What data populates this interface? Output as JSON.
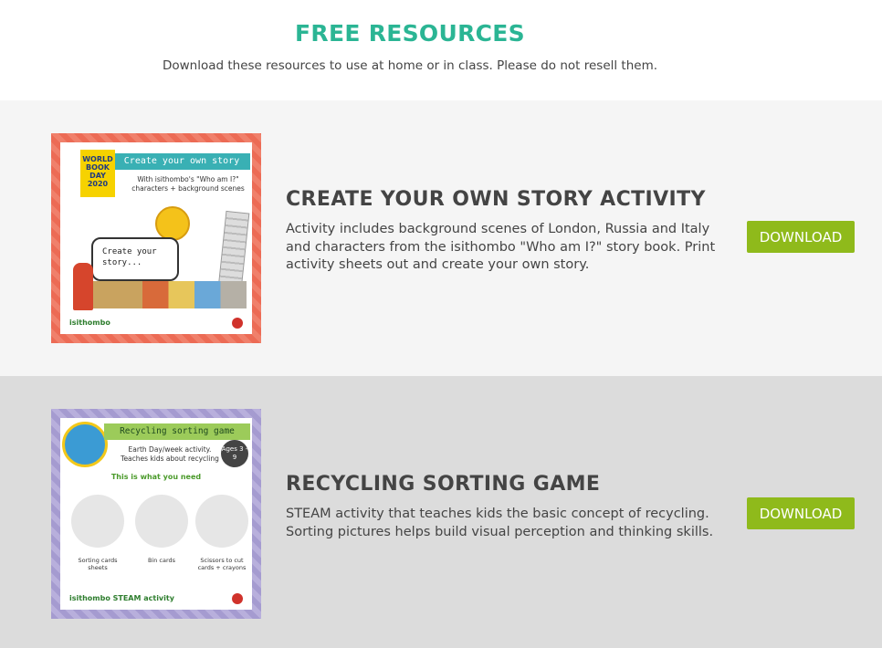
{
  "header": {
    "title": "FREE RESOURCES",
    "subtitle": "Download these resources to use at home or in class. Please do not resell them."
  },
  "resources": [
    {
      "title": "CREATE YOUR OWN STORY ACTIVITY",
      "description": "Activity includes background scenes of London, Russia and Italy and characters from the isithombo \"Who am I?\" story book. Print activity sheets out and create your own story.",
      "button": "DOWNLOAD",
      "thumb": {
        "badge": "WORLD BOOK DAY 2020",
        "banner": "Create your own story",
        "sub": "With isithombo's \"Who am I?\" characters + background scenes",
        "bubble": "Create your story...",
        "brand": "isithombo"
      }
    },
    {
      "title": "RECYCLING SORTING GAME",
      "description": "STEAM activity that teaches kids the basic concept of recycling. Sorting pictures helps build visual perception and thinking skills.",
      "button": "DOWNLOAD",
      "thumb": {
        "banner": "Recycling sorting game",
        "sub": "Earth Day/week activity. Teaches kids about recycling",
        "ages": "Ages 3 - 9",
        "need": "This is what you need",
        "item1": "Sorting cards sheets",
        "item2": "Bin cards",
        "item3": "Scissors to cut cards + crayons",
        "brand": "isithombo  STEAM activity"
      }
    }
  ],
  "colors": {
    "accent": "#2bb594",
    "button": "#8fba1b"
  }
}
